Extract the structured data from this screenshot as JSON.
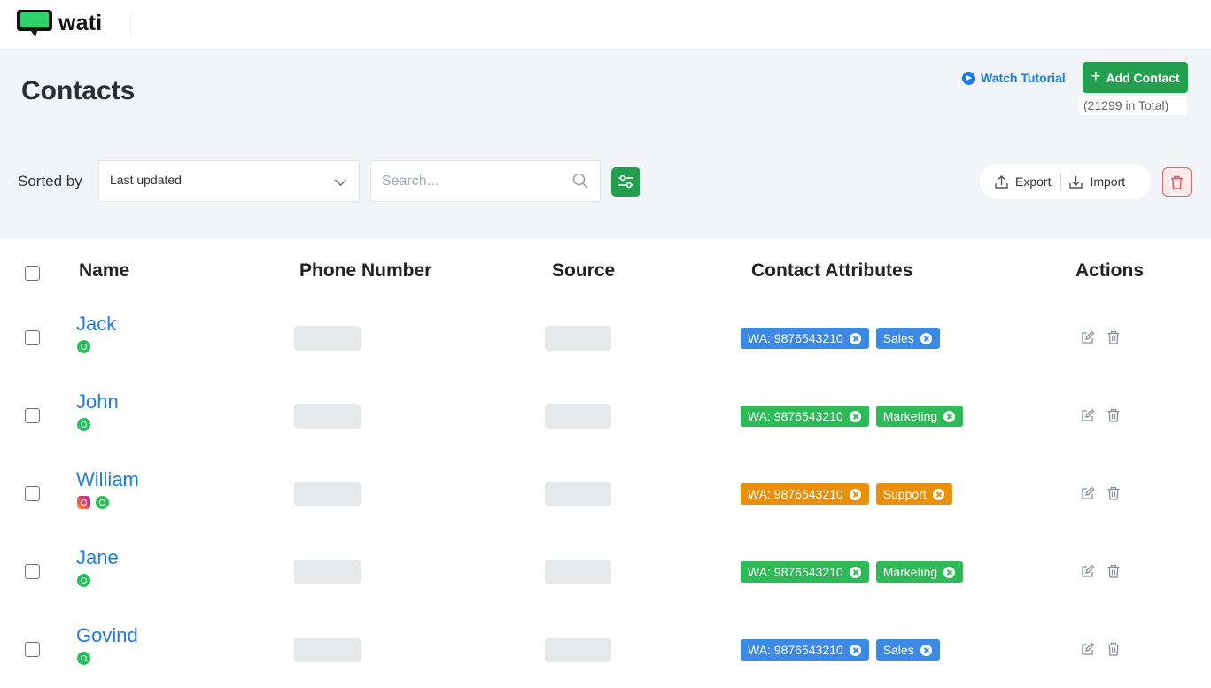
{
  "brand": {
    "name": "wati"
  },
  "page": {
    "title": "Contacts"
  },
  "actions": {
    "watch_tutorial": "Watch Tutorial",
    "add_contact": "Add Contact",
    "total": "(21299 in Total)"
  },
  "toolbar": {
    "sorted_by_label": "Sorted by",
    "sort_value": "Last updated",
    "search_placeholder": "Search...",
    "export": "Export",
    "import": "Import"
  },
  "colors": {
    "green": "#22a04f",
    "blue_tag": "#3d8ae6",
    "green_tag": "#2dbb57",
    "orange_tag": "#e8900a",
    "link": "#1f7be0"
  },
  "table": {
    "columns": [
      "Name",
      "Phone Number",
      "Source",
      "Contact Attributes",
      "Actions"
    ],
    "rows": [
      {
        "name": "Jack",
        "channels": [
          "whatsapp"
        ],
        "tag_color": "#3d8ae6",
        "tags": [
          "WA: 9876543210",
          "Sales"
        ]
      },
      {
        "name": "John",
        "channels": [
          "whatsapp"
        ],
        "tag_color": "#2dbb57",
        "tags": [
          "WA: 9876543210",
          "Marketing"
        ]
      },
      {
        "name": "William",
        "channels": [
          "instagram",
          "whatsapp"
        ],
        "tag_color": "#e8900a",
        "tags": [
          "WA: 9876543210",
          "Support"
        ]
      },
      {
        "name": "Jane",
        "channels": [
          "whatsapp"
        ],
        "tag_color": "#2dbb57",
        "tags": [
          "WA: 9876543210",
          "Marketing"
        ]
      },
      {
        "name": "Govind",
        "channels": [
          "whatsapp"
        ],
        "tag_color": "#3d8ae6",
        "tags": [
          "WA: 9876543210",
          "Sales"
        ]
      }
    ]
  }
}
